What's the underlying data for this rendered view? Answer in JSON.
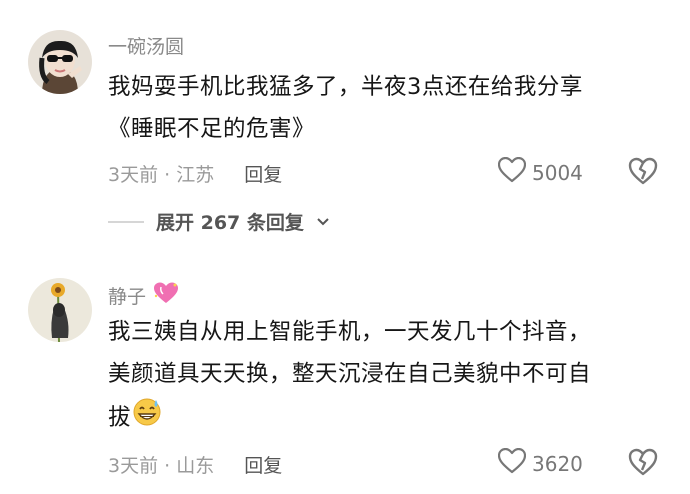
{
  "comments": [
    {
      "username": "一碗汤圆",
      "content_line1": "我妈耍手机比我猛多了，半夜3点还在给我分享",
      "content_line2": "《睡眠不足的危害》",
      "time": "3天前 · 江苏",
      "reply_label": "回复",
      "likes": "5004",
      "replies_expand": "展开 267 条回复"
    },
    {
      "username": "静子",
      "content_line1": "我三姨自从用上智能手机，一天发几十个抖音，",
      "content_line2": "美颜道具天天换，整天沉浸在自己美貌中不可自",
      "content_line3": "拔",
      "time": "3天前 · 山东",
      "reply_label": "回复",
      "likes": "3620"
    }
  ]
}
